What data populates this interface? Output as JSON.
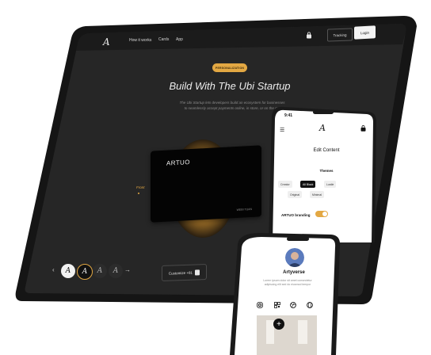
{
  "tablet": {
    "nav": {
      "logo": "A",
      "links": [
        "How it works",
        "Cards",
        "App"
      ],
      "tracking_label": "Tracking",
      "login_label": "Login"
    },
    "hero": {
      "badge": "PERSONALIZATION",
      "title": "Build With The Ubi Startup",
      "subtitle_line1": "The Ubi Startup lets developers build an ecosystem for businesses",
      "subtitle_line2": "to seamlessly accept payments online, in store, or on the go."
    },
    "card": {
      "brand": "ARTUO",
      "holder": "WEBI TUAN"
    },
    "front_label": "Front",
    "logo_options": [
      "A",
      "A",
      "A",
      "A"
    ],
    "customize_label": "Customize +81"
  },
  "phone_edit": {
    "time": "9:41",
    "logo": "A",
    "title": "Edit Content",
    "themes_label": "Themes",
    "themes": [
      "Creator",
      "All Black",
      "Lustle",
      "Original",
      "Minimal"
    ],
    "active_theme": "All Black",
    "branding_label": "ARTUO branding",
    "branding_on": true,
    "accent_color": "#e3a843"
  },
  "phone_profile": {
    "name": "Artyverse",
    "bio_line1": "Lorem ipsum dolor sit amet consectetur",
    "bio_line2": "adipiscing elit sed do eiusmod tempor",
    "social_icons": [
      "instagram-icon",
      "qr-code-icon",
      "dribbble-icon",
      "globe-icon"
    ],
    "fab": "+"
  }
}
